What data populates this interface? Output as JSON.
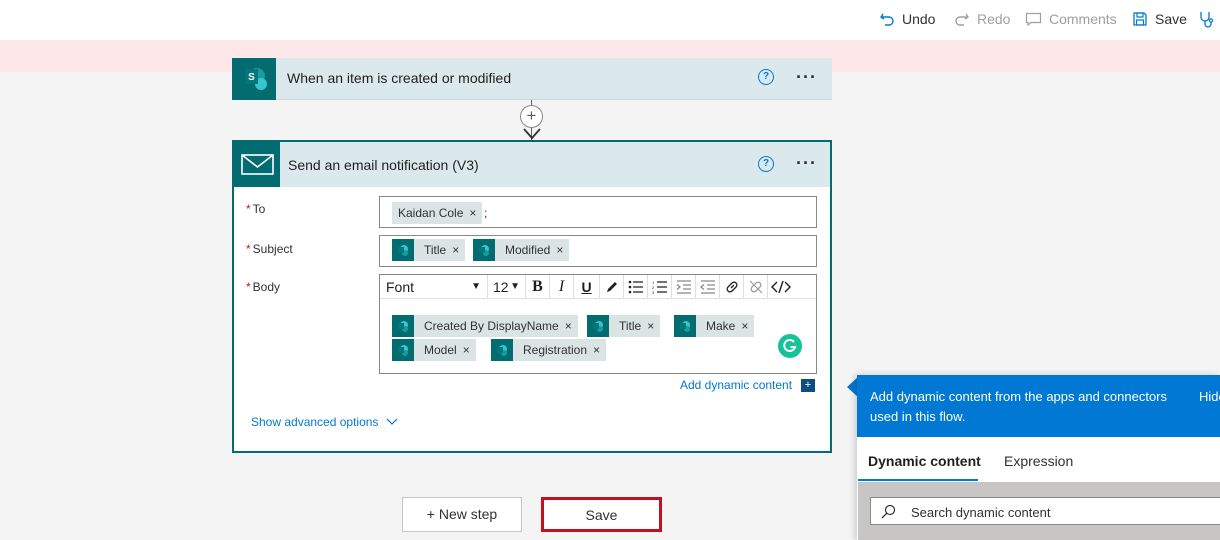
{
  "cmdbar": {
    "undo": "Undo",
    "redo": "Redo",
    "comments": "Comments",
    "save": "Save"
  },
  "trigger": {
    "title": "When an item is created or modified",
    "help": "?",
    "more": "···"
  },
  "action": {
    "title": "Send an email notification (V3)",
    "help": "?",
    "more": "···",
    "to": {
      "label": "To",
      "tokens": [
        "Kaidan Cole"
      ],
      "separator": ";"
    },
    "subject": {
      "label": "Subject",
      "tokens": [
        "Title",
        "Modified"
      ]
    },
    "body": {
      "label": "Body",
      "font": "Font",
      "size": "12",
      "tokens": [
        "Created By DisplayName",
        "Title",
        "Make",
        "Model",
        "Registration"
      ]
    },
    "add_dynamic": "Add dynamic content",
    "show_advanced": "Show advanced options"
  },
  "buttons": {
    "new_step": "+ New step",
    "save": "Save"
  },
  "panel": {
    "header": "Add dynamic content from the apps and connectors used in this flow.",
    "hide": "Hide",
    "tabs": [
      "Dynamic content",
      "Expression"
    ],
    "search_placeholder": "Search dynamic content"
  },
  "colors": {
    "brand": "#036c70",
    "accent": "#0078d4",
    "banner": "#fde7e9",
    "save_outline": "#c50f1f"
  }
}
